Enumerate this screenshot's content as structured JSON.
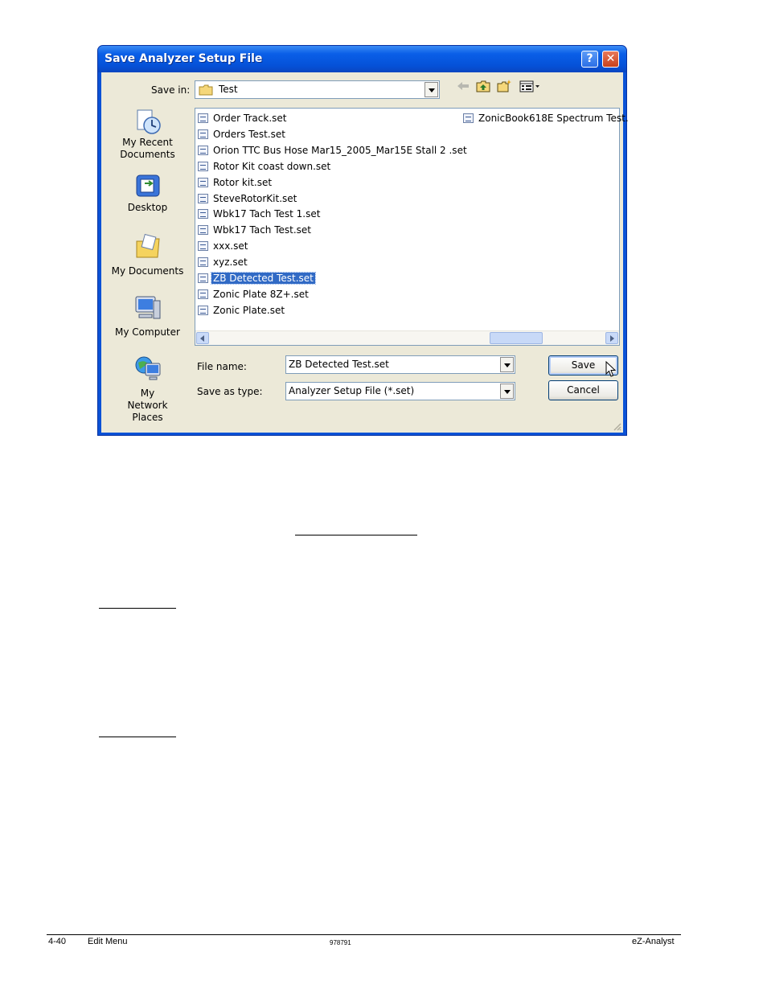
{
  "dialog": {
    "title": "Save Analyzer Setup File",
    "help_label": "?",
    "close_label": "✕",
    "save_in_label": "Save in:",
    "save_in_value": "Test",
    "places": [
      "My Recent Documents",
      "Desktop",
      "My Documents",
      "My Computer",
      "My Network Places"
    ],
    "files_col1": [
      "Order Track.set",
      "Orders Test.set",
      "Orion TTC Bus Hose Mar15_2005_Mar15E Stall 2 .set",
      "Rotor Kit coast down.set",
      "Rotor kit.set",
      "SteveRotorKit.set",
      "Wbk17 Tach Test 1.set",
      "Wbk17 Tach Test.set",
      "xxx.set",
      "xyz.set",
      "ZB Detected Test.set",
      "Zonic Plate 8Z+.set",
      "Zonic Plate.set"
    ],
    "files_col2": [
      "ZonicBook618E Spectrum Test."
    ],
    "selected_file": "ZB Detected Test.set",
    "file_name_label": "File name:",
    "file_name_value": "ZB Detected Test.set",
    "save_type_label": "Save as type:",
    "save_type_value": "Analyzer Setup File (*.set)",
    "save_button": "Save",
    "cancel_button": "Cancel"
  },
  "footer": {
    "page": "4-40",
    "section": "Edit Menu",
    "doc_number": "978791",
    "product": "eZ-Analyst"
  }
}
